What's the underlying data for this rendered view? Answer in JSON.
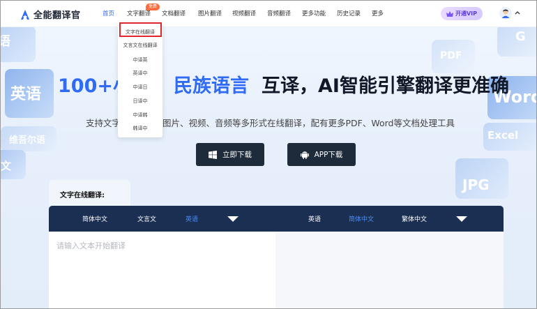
{
  "app": {
    "title": "全能翻译官"
  },
  "nav": {
    "items": [
      "首页",
      "文字翻译",
      "文档翻译",
      "图片翻译",
      "视频翻译",
      "音频翻译",
      "更多功能",
      "历史记录",
      "更多"
    ],
    "active_index": 0,
    "badge": "免费"
  },
  "header": {
    "vip_label": "开通VIP"
  },
  "dropdown": {
    "items": [
      "文字在线翻译",
      "文言文在线翻译",
      "中译英",
      "英译中",
      "中译日",
      "日译中",
      "中译韩",
      "韩译中"
    ],
    "highlighted_index": 0
  },
  "hero": {
    "title_part1": "100+小",
    "title_part2": "民族语言",
    "title_part3": "互译，AI智能引擎翻译更准确",
    "subtitle_left": "支持文字",
    "subtitle_right": "图片、视频、音频等多形式在线翻译，配有更多PDF、Word等文档处理工具",
    "btn_download": "立即下载",
    "btn_app": "APP下载"
  },
  "decorations": {
    "left": [
      "语",
      "英语",
      "维吾尔语",
      "文"
    ],
    "right": [
      "PDF",
      "Word",
      "Excel",
      "JPG",
      "G"
    ]
  },
  "translator": {
    "section_label": "文字在线翻译:",
    "source_langs": [
      "简体中文",
      "文言文",
      "英语"
    ],
    "source_selected": 2,
    "target_langs": [
      "英语",
      "简体中文",
      "繁体中文"
    ],
    "target_selected": 1,
    "placeholder": "请输入文本开始翻译"
  },
  "colors": {
    "accent": "#2f6bf5",
    "dark_button": "#1e2b3b",
    "lang_bar": "#1b2f52",
    "highlight_red": "#e0252b"
  }
}
